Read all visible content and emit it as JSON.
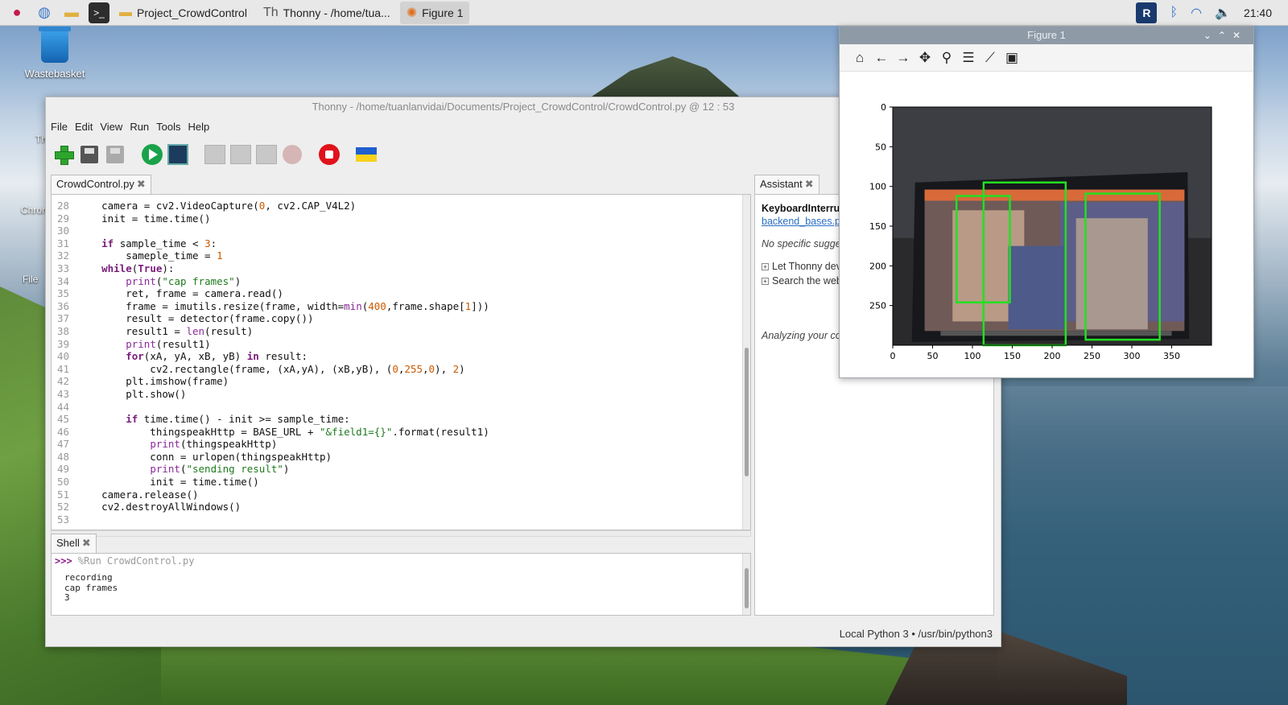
{
  "taskbar": {
    "project_folder": "Project_CrowdControl",
    "thonny_task": "Thonny  -  /home/tua...",
    "figure_task": "Figure 1",
    "clock": "21:40"
  },
  "desktop": {
    "wastebasket": "Wastebasket",
    "partial_labels": [
      "Th",
      "Chron",
      "File"
    ]
  },
  "thonny": {
    "title": "Thonny  -  /home/tuanlanvidai/Documents/Project_CrowdControl/CrowdControl.py  @  12 : 53",
    "menu": [
      "File",
      "Edit",
      "View",
      "Run",
      "Tools",
      "Help"
    ],
    "editor_tab": "CrowdControl.py",
    "code_lines": [
      {
        "n": "28",
        "t": "    camera = cv2.VideoCapture(0, cv2.CAP_V4L2)"
      },
      {
        "n": "29",
        "t": "    init = time.time()"
      },
      {
        "n": "30",
        "t": ""
      },
      {
        "n": "31",
        "t": "    if sample_time < 3:"
      },
      {
        "n": "32",
        "t": "        sameple_time = 1"
      },
      {
        "n": "33",
        "t": "    while(True):"
      },
      {
        "n": "34",
        "t": "        print(\"cap frames\")"
      },
      {
        "n": "35",
        "t": "        ret, frame = camera.read()"
      },
      {
        "n": "36",
        "t": "        frame = imutils.resize(frame, width=min(400,frame.shape[1]))"
      },
      {
        "n": "37",
        "t": "        result = detector(frame.copy())"
      },
      {
        "n": "38",
        "t": "        result1 = len(result)"
      },
      {
        "n": "39",
        "t": "        print(result1)"
      },
      {
        "n": "40",
        "t": "        for(xA, yA, xB, yB) in result:"
      },
      {
        "n": "41",
        "t": "            cv2.rectangle(frame, (xA,yA), (xB,yB), (0,255,0), 2)"
      },
      {
        "n": "42",
        "t": "        plt.imshow(frame)"
      },
      {
        "n": "43",
        "t": "        plt.show()"
      },
      {
        "n": "44",
        "t": ""
      },
      {
        "n": "45",
        "t": "        if time.time() - init >= sample_time:"
      },
      {
        "n": "46",
        "t": "            thingspeakHttp = BASE_URL + \"&field1={}\".format(result1)"
      },
      {
        "n": "47",
        "t": "            print(thingspeakHttp)"
      },
      {
        "n": "48",
        "t": "            conn = urlopen(thingspeakHttp)"
      },
      {
        "n": "49",
        "t": "            print(\"sending result\")"
      },
      {
        "n": "50",
        "t": "            init = time.time()"
      },
      {
        "n": "51",
        "t": "    camera.release()"
      },
      {
        "n": "52",
        "t": "    cv2.destroyAllWindows()"
      },
      {
        "n": "53",
        "t": ""
      }
    ],
    "shell_tab": "Shell",
    "shell_prompt": ">>>",
    "shell_command": "%Run CrowdControl.py",
    "shell_output": [
      "recording",
      "cap frames",
      "3"
    ],
    "assistant_tab": "Assistant",
    "assistant": {
      "heading": "KeyboardInterru",
      "link": "backend_bases.p",
      "no_suggestions": "No specific sugge",
      "tree": [
        "Let Thonny dev",
        "Search the web"
      ],
      "analyzing": "Analyzing your coc"
    },
    "status": "Local Python 3  •  /usr/bin/python3"
  },
  "figure": {
    "title": "Figure 1",
    "toolbar_icons": [
      "home-icon",
      "back-icon",
      "forward-icon",
      "pan-icon",
      "zoom-icon",
      "configure-icon",
      "axes-edit-icon",
      "save-icon"
    ]
  },
  "chart_data": {
    "type": "image",
    "xticks": [
      0,
      50,
      100,
      150,
      200,
      250,
      300,
      350
    ],
    "yticks": [
      0,
      50,
      100,
      150,
      200,
      250
    ],
    "xlim": [
      0,
      400
    ],
    "ylim": [
      300,
      0
    ],
    "detections": [
      {
        "xA": 80,
        "yA": 112,
        "xB": 147,
        "yB": 246
      },
      {
        "xA": 114,
        "yA": 95,
        "xB": 217,
        "yB": 300
      },
      {
        "xA": 242,
        "yA": 109,
        "xB": 335,
        "yB": 293
      }
    ],
    "box_color": "#22e022"
  }
}
